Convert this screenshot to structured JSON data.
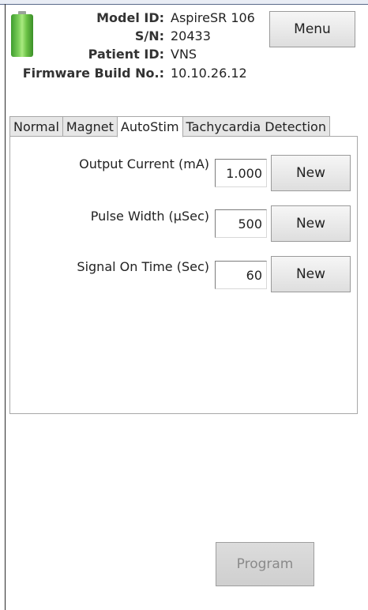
{
  "battery": {
    "icon": "battery-full-icon",
    "color": "#5fbf3c"
  },
  "header": {
    "model_label": "Model ID:",
    "model_value": "AspireSR 106",
    "sn_label": "S/N:",
    "sn_value": "20433",
    "patient_label": "Patient ID:",
    "patient_value": "VNS",
    "firmware_label": "Firmware Build No.:",
    "firmware_value": "10.10.26.12"
  },
  "menu_button": {
    "label": "Menu"
  },
  "tabs": [
    {
      "label": "Normal",
      "active": false
    },
    {
      "label": "Magnet",
      "active": false
    },
    {
      "label": "AutoStim",
      "active": true
    },
    {
      "label": "Tachycardia Detection",
      "active": false
    }
  ],
  "fields": [
    {
      "label": "Output Current (mA)",
      "value": "1.000",
      "button": "New"
    },
    {
      "label": "Pulse Width (µSec)",
      "value": "500",
      "button": "New"
    },
    {
      "label": "Signal On Time (Sec)",
      "value": "60",
      "button": "New"
    }
  ],
  "program_button": {
    "label": "Program",
    "enabled": false
  }
}
